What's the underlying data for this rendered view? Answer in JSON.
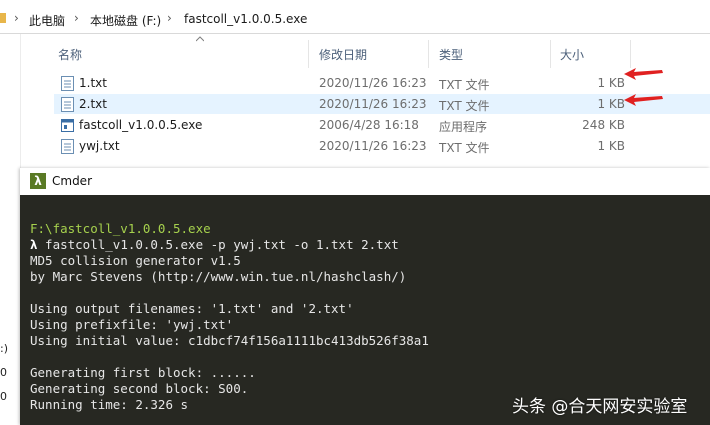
{
  "explorer": {
    "breadcrumb": [
      "此电脑",
      "本地磁盘 (F:)",
      "fastcoll_v1.0.0.5.exe"
    ],
    "columns": {
      "name": "名称",
      "date": "修改日期",
      "type": "类型",
      "size": "大小"
    },
    "files": [
      {
        "name": "1.txt",
        "date": "2020/11/26 16:23",
        "type": "TXT 文件",
        "size": "1 KB",
        "icon": "text-file-icon"
      },
      {
        "name": "2.txt",
        "date": "2020/11/26 16:23",
        "type": "TXT 文件",
        "size": "1 KB",
        "icon": "text-file-icon",
        "selected": true
      },
      {
        "name": "fastcoll_v1.0.0.5.exe",
        "date": "2006/4/28 16:18",
        "type": "应用程序",
        "size": "248 KB",
        "icon": "exe-file-icon"
      },
      {
        "name": "ywj.txt",
        "date": "2020/11/26 16:23",
        "type": "TXT 文件",
        "size": "1 KB",
        "icon": "text-file-icon"
      }
    ]
  },
  "left_strip": [
    ":)",
    "0",
    "0"
  ],
  "cmder": {
    "title": "Cmder",
    "badge": "λ",
    "lines": [
      {
        "text": "F:\\fastcoll_v1.0.0.5.exe",
        "style": "path"
      },
      {
        "prompt": "λ",
        "text": " fastcoll_v1.0.0.5.exe -p ywj.txt -o 1.txt 2.txt"
      },
      {
        "text": "MD5 collision generator v1.5"
      },
      {
        "text": "by Marc Stevens (http://www.win.tue.nl/hashclash/)"
      },
      {
        "text": ""
      },
      {
        "text": "Using output filenames: '1.txt' and '2.txt'"
      },
      {
        "text": "Using prefixfile: 'ywj.txt'"
      },
      {
        "text": "Using initial value: c1dbcf74f156a1111bc413db526f38a1"
      },
      {
        "text": ""
      },
      {
        "text": "Generating first block: ......"
      },
      {
        "text": "Generating second block: S00."
      },
      {
        "text": "Running time: 2.326 s"
      }
    ]
  },
  "watermark": "头条 @合天网安实验室",
  "colors": {
    "accent_red": "#e02020",
    "terminal_bg": "#272822",
    "path_green": "#a6d14d",
    "selection": "#e5f3ff"
  }
}
